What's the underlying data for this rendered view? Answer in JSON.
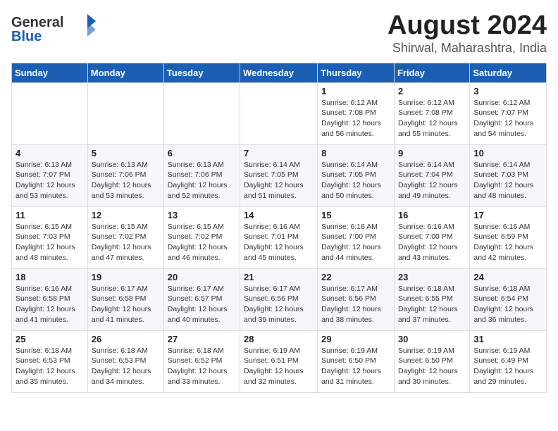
{
  "logo": {
    "general": "General",
    "blue": "Blue"
  },
  "title": "August 2024",
  "subtitle": "Shirwal, Maharashtra, India",
  "days_of_week": [
    "Sunday",
    "Monday",
    "Tuesday",
    "Wednesday",
    "Thursday",
    "Friday",
    "Saturday"
  ],
  "weeks": [
    [
      {
        "day": "",
        "info": ""
      },
      {
        "day": "",
        "info": ""
      },
      {
        "day": "",
        "info": ""
      },
      {
        "day": "",
        "info": ""
      },
      {
        "day": "1",
        "info": "Sunrise: 6:12 AM\nSunset: 7:08 PM\nDaylight: 12 hours\nand 56 minutes."
      },
      {
        "day": "2",
        "info": "Sunrise: 6:12 AM\nSunset: 7:08 PM\nDaylight: 12 hours\nand 55 minutes."
      },
      {
        "day": "3",
        "info": "Sunrise: 6:12 AM\nSunset: 7:07 PM\nDaylight: 12 hours\nand 54 minutes."
      }
    ],
    [
      {
        "day": "4",
        "info": "Sunrise: 6:13 AM\nSunset: 7:07 PM\nDaylight: 12 hours\nand 53 minutes."
      },
      {
        "day": "5",
        "info": "Sunrise: 6:13 AM\nSunset: 7:06 PM\nDaylight: 12 hours\nand 53 minutes."
      },
      {
        "day": "6",
        "info": "Sunrise: 6:13 AM\nSunset: 7:06 PM\nDaylight: 12 hours\nand 52 minutes."
      },
      {
        "day": "7",
        "info": "Sunrise: 6:14 AM\nSunset: 7:05 PM\nDaylight: 12 hours\nand 51 minutes."
      },
      {
        "day": "8",
        "info": "Sunrise: 6:14 AM\nSunset: 7:05 PM\nDaylight: 12 hours\nand 50 minutes."
      },
      {
        "day": "9",
        "info": "Sunrise: 6:14 AM\nSunset: 7:04 PM\nDaylight: 12 hours\nand 49 minutes."
      },
      {
        "day": "10",
        "info": "Sunrise: 6:14 AM\nSunset: 7:03 PM\nDaylight: 12 hours\nand 48 minutes."
      }
    ],
    [
      {
        "day": "11",
        "info": "Sunrise: 6:15 AM\nSunset: 7:03 PM\nDaylight: 12 hours\nand 48 minutes."
      },
      {
        "day": "12",
        "info": "Sunrise: 6:15 AM\nSunset: 7:02 PM\nDaylight: 12 hours\nand 47 minutes."
      },
      {
        "day": "13",
        "info": "Sunrise: 6:15 AM\nSunset: 7:02 PM\nDaylight: 12 hours\nand 46 minutes."
      },
      {
        "day": "14",
        "info": "Sunrise: 6:16 AM\nSunset: 7:01 PM\nDaylight: 12 hours\nand 45 minutes."
      },
      {
        "day": "15",
        "info": "Sunrise: 6:16 AM\nSunset: 7:00 PM\nDaylight: 12 hours\nand 44 minutes."
      },
      {
        "day": "16",
        "info": "Sunrise: 6:16 AM\nSunset: 7:00 PM\nDaylight: 12 hours\nand 43 minutes."
      },
      {
        "day": "17",
        "info": "Sunrise: 6:16 AM\nSunset: 6:59 PM\nDaylight: 12 hours\nand 42 minutes."
      }
    ],
    [
      {
        "day": "18",
        "info": "Sunrise: 6:16 AM\nSunset: 6:58 PM\nDaylight: 12 hours\nand 41 minutes."
      },
      {
        "day": "19",
        "info": "Sunrise: 6:17 AM\nSunset: 6:58 PM\nDaylight: 12 hours\nand 41 minutes."
      },
      {
        "day": "20",
        "info": "Sunrise: 6:17 AM\nSunset: 6:57 PM\nDaylight: 12 hours\nand 40 minutes."
      },
      {
        "day": "21",
        "info": "Sunrise: 6:17 AM\nSunset: 6:56 PM\nDaylight: 12 hours\nand 39 minutes."
      },
      {
        "day": "22",
        "info": "Sunrise: 6:17 AM\nSunset: 6:56 PM\nDaylight: 12 hours\nand 38 minutes."
      },
      {
        "day": "23",
        "info": "Sunrise: 6:18 AM\nSunset: 6:55 PM\nDaylight: 12 hours\nand 37 minutes."
      },
      {
        "day": "24",
        "info": "Sunrise: 6:18 AM\nSunset: 6:54 PM\nDaylight: 12 hours\nand 36 minutes."
      }
    ],
    [
      {
        "day": "25",
        "info": "Sunrise: 6:18 AM\nSunset: 6:53 PM\nDaylight: 12 hours\nand 35 minutes."
      },
      {
        "day": "26",
        "info": "Sunrise: 6:18 AM\nSunset: 6:53 PM\nDaylight: 12 hours\nand 34 minutes."
      },
      {
        "day": "27",
        "info": "Sunrise: 6:18 AM\nSunset: 6:52 PM\nDaylight: 12 hours\nand 33 minutes."
      },
      {
        "day": "28",
        "info": "Sunrise: 6:19 AM\nSunset: 6:51 PM\nDaylight: 12 hours\nand 32 minutes."
      },
      {
        "day": "29",
        "info": "Sunrise: 6:19 AM\nSunset: 6:50 PM\nDaylight: 12 hours\nand 31 minutes."
      },
      {
        "day": "30",
        "info": "Sunrise: 6:19 AM\nSunset: 6:50 PM\nDaylight: 12 hours\nand 30 minutes."
      },
      {
        "day": "31",
        "info": "Sunrise: 6:19 AM\nSunset: 6:49 PM\nDaylight: 12 hours\nand 29 minutes."
      }
    ]
  ]
}
